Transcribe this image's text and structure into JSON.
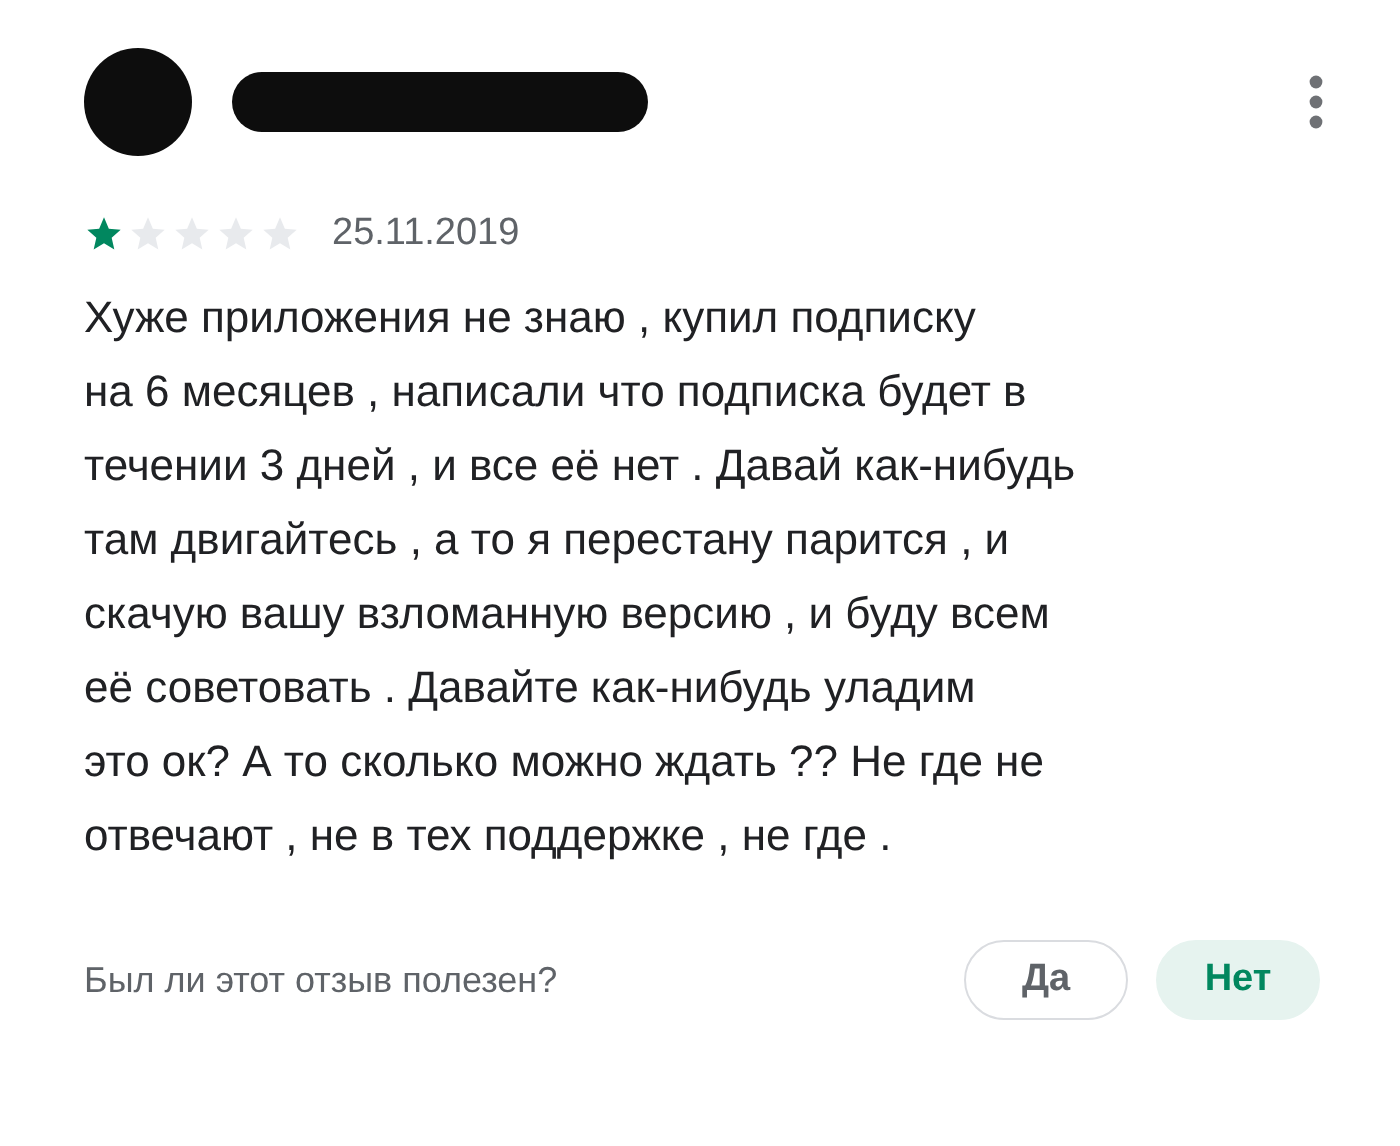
{
  "review": {
    "stars": 1,
    "date": "25.11.2019",
    "text": "Хуже приложения не знаю , купил подписку\nна 6 месяцев , написали что подписка будет в\nтечении 3 дней , и все её нет . Давай как-нибудь\nтам двигайтесь , а то я перестану парится , и\nскачую вашу взломанную версию , и буду всем\nеё советовать . Давайте как-нибудь уладим\nэто ок? А то сколько можно ждать ?? Не где не\nотвечают , не в тех поддержке , не где ."
  },
  "helpful": {
    "question": "Был ли этот отзыв полезен?",
    "buttons": [
      {
        "label": "Да",
        "selected": false
      },
      {
        "label": "Нет",
        "selected": true
      }
    ]
  }
}
